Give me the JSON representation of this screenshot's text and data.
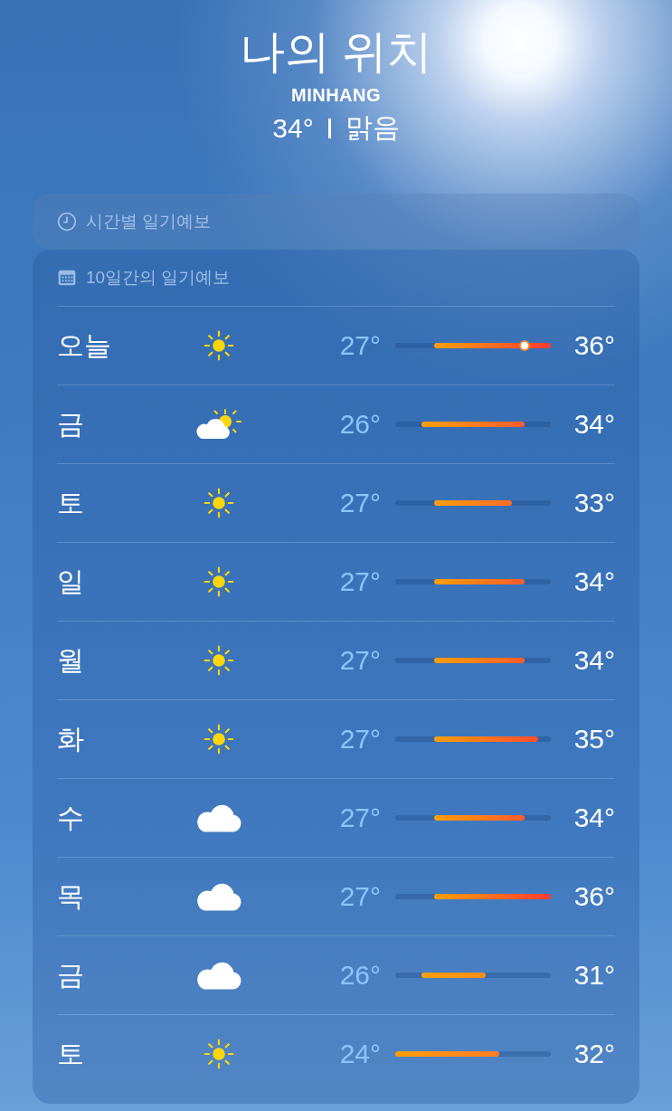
{
  "location": {
    "title": "나의 위치",
    "city": "MINHANG",
    "current_temp": "34°",
    "condition": "맑음"
  },
  "hourly": {
    "title": "시간별 일기예보"
  },
  "daily": {
    "title": "10일간의 일기예보",
    "days": [
      {
        "day": "오늘",
        "kind": "sun",
        "low": "27°",
        "high": "36°",
        "current": true
      },
      {
        "day": "금",
        "kind": "partly_cloudy",
        "low": "26°",
        "high": "34°",
        "current": false
      },
      {
        "day": "토",
        "kind": "sun",
        "low": "27°",
        "high": "33°",
        "current": false
      },
      {
        "day": "일",
        "kind": "sun",
        "low": "27°",
        "high": "34°",
        "current": false
      },
      {
        "day": "월",
        "kind": "sun",
        "low": "27°",
        "high": "34°",
        "current": false
      },
      {
        "day": "화",
        "kind": "sun",
        "low": "27°",
        "high": "35°",
        "current": false
      },
      {
        "day": "수",
        "kind": "cloud",
        "low": "27°",
        "high": "34°",
        "current": false
      },
      {
        "day": "목",
        "kind": "cloud",
        "low": "27°",
        "high": "36°",
        "current": false
      },
      {
        "day": "금",
        "kind": "cloud",
        "low": "26°",
        "high": "31°",
        "current": false
      },
      {
        "day": "토",
        "kind": "sun",
        "low": "24°",
        "high": "32°",
        "current": false
      }
    ]
  }
}
